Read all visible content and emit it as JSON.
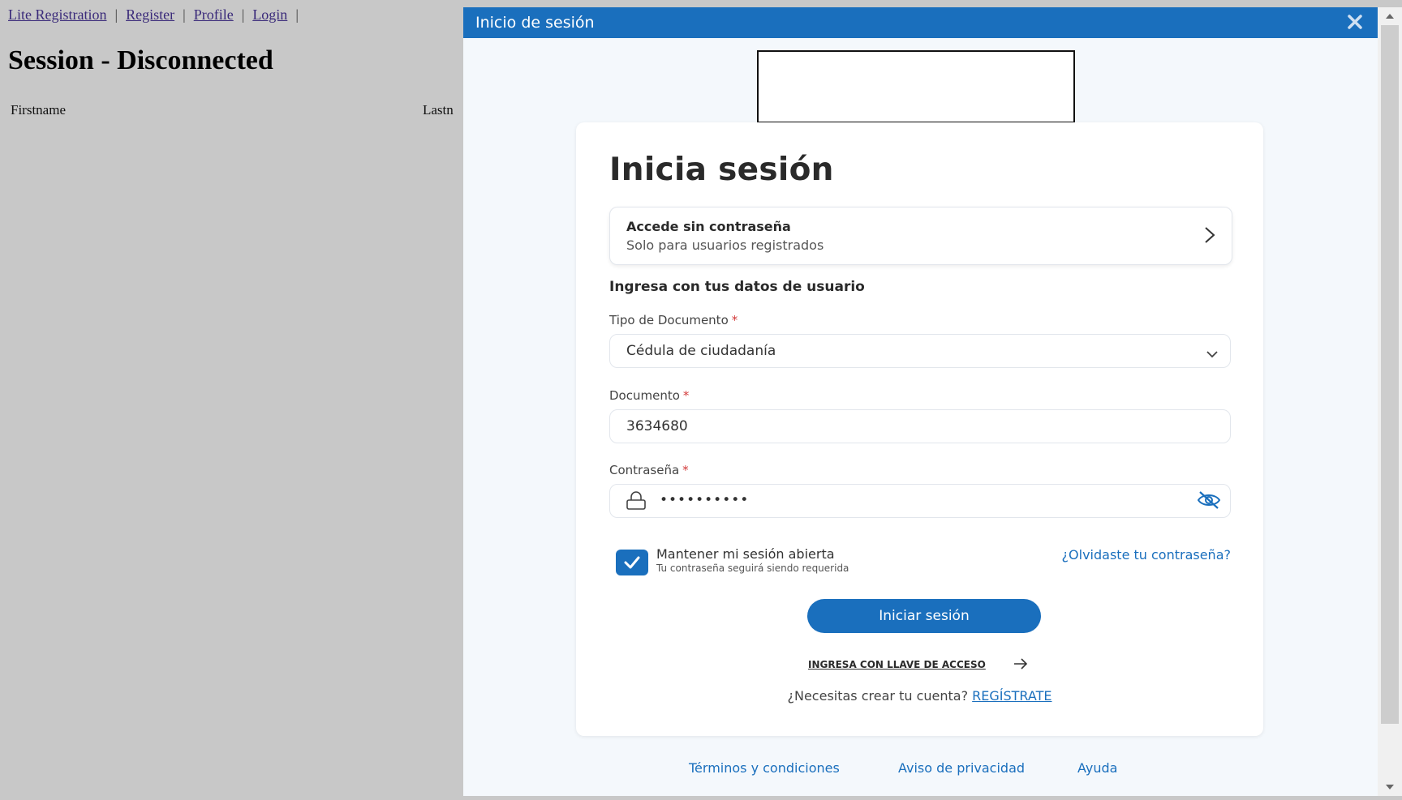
{
  "background": {
    "nav": [
      "Lite Registration",
      "Register",
      "Profile",
      "Login"
    ],
    "nav_separator": "|",
    "heading": "Session - Disconnected",
    "columns": {
      "first": "Firstname",
      "last": "Lastn"
    }
  },
  "modal": {
    "title": "Inicio de sesión",
    "card": {
      "title": "Inicia sesión",
      "passwordless": {
        "title": "Accede sin contraseña",
        "subtitle": "Solo para usuarios registrados"
      },
      "section_title": "Ingresa con tus datos de usuario",
      "required_mark": "*",
      "doc_type": {
        "label": "Tipo de Documento",
        "value": "Cédula de ciudadanía"
      },
      "document": {
        "label": "Documento",
        "value": "3634680"
      },
      "password": {
        "label": "Contraseña",
        "value": "••••••••••"
      },
      "keep_session": {
        "label": "Mantener mi sesión abierta",
        "sublabel": "Tu contraseña seguirá siendo requerida",
        "checked": true
      },
      "forgot": "¿Olvidaste tu contraseña?",
      "submit": "Iniciar sesión",
      "passkey": "INGRESA CON LLAVE DE ACCESO",
      "create_prompt": "¿Necesitas crear tu cuenta?",
      "register": "REGÍSTRATE"
    },
    "footer": {
      "terms": "Términos y condiciones",
      "privacy": "Aviso de privacidad",
      "help": "Ayuda"
    }
  },
  "colors": {
    "primary": "#1a6fbd",
    "background": "#c8c8c8",
    "required": "#d23a3a"
  },
  "icons": [
    "close-icon",
    "chevron-right-icon",
    "chevron-down-icon",
    "lock-icon",
    "eye-off-icon",
    "check-icon",
    "arrow-right-icon"
  ]
}
